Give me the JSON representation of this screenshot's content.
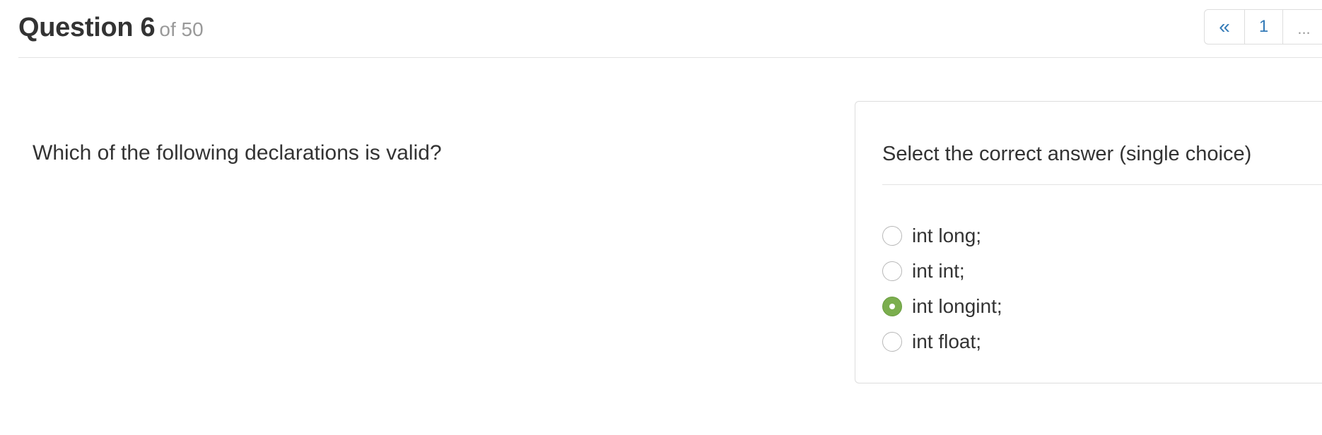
{
  "header": {
    "title": "Question 6",
    "subtitle": "of 50"
  },
  "pagination": {
    "prev_label": "«",
    "current_page": "1",
    "more_label": "..."
  },
  "question": {
    "text": "Which of the following declarations is valid?"
  },
  "answer_panel": {
    "heading": "Select the correct answer (single choice)",
    "options": [
      {
        "label": "int long;",
        "selected": false
      },
      {
        "label": "int int;",
        "selected": false
      },
      {
        "label": "int longint;",
        "selected": true
      },
      {
        "label": "int float;",
        "selected": false
      }
    ]
  },
  "colors": {
    "selected_radio": "#7bae4e",
    "link": "#337ab7"
  }
}
